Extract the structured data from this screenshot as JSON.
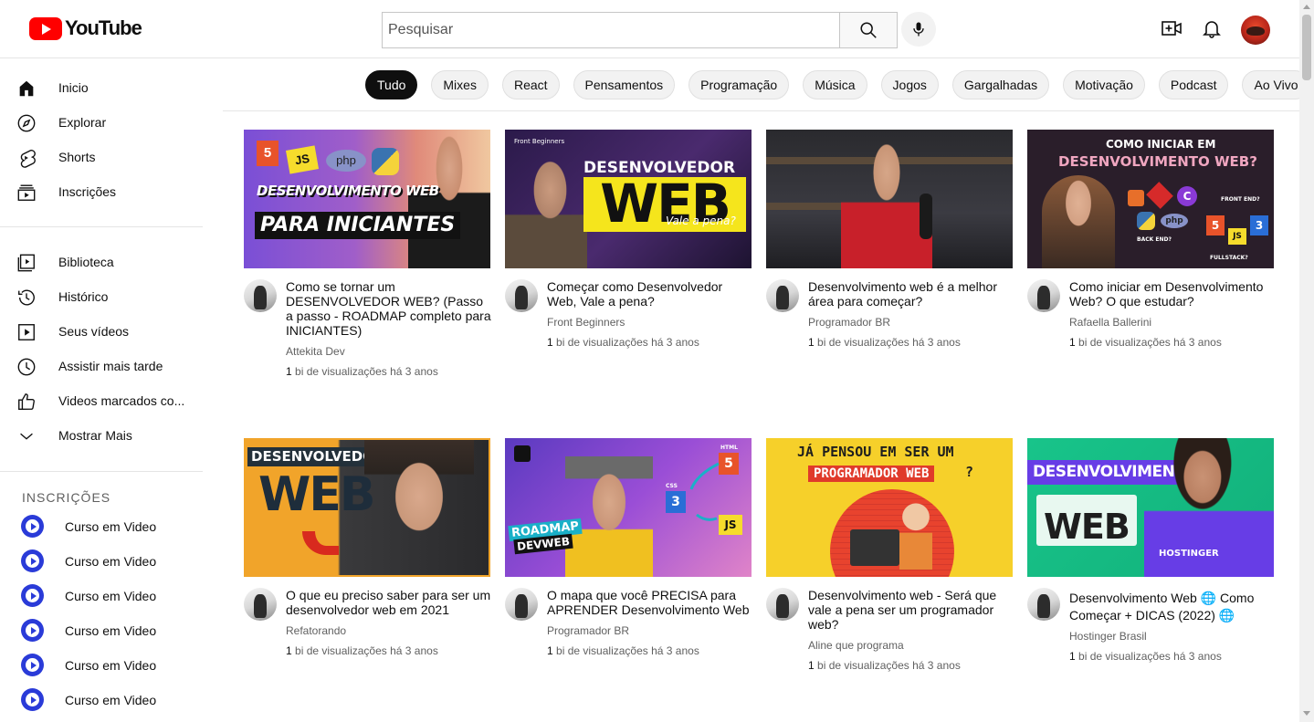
{
  "header": {
    "logo_text": "YouTube",
    "search_placeholder": "Pesquisar"
  },
  "sidebar": {
    "main": [
      {
        "label": "Inicio",
        "icon": "home-icon"
      },
      {
        "label": "Explorar",
        "icon": "compass-icon"
      },
      {
        "label": "Shorts",
        "icon": "shorts-icon"
      },
      {
        "label": "Inscrições",
        "icon": "subscriptions-icon"
      }
    ],
    "library": [
      {
        "label": "Biblioteca",
        "icon": "library-icon"
      },
      {
        "label": "Histórico",
        "icon": "history-icon"
      },
      {
        "label": "Seus vídeos",
        "icon": "your-videos-icon"
      },
      {
        "label": "Assistir mais tarde",
        "icon": "watch-later-icon"
      },
      {
        "label": "Videos marcados co...",
        "icon": "liked-icon"
      },
      {
        "label": "Mostrar Mais",
        "icon": "chevron-down-icon"
      }
    ],
    "subscriptions_title": "INSCRIÇÕES",
    "subscriptions": [
      {
        "label": "Curso em Video"
      },
      {
        "label": "Curso em Video"
      },
      {
        "label": "Curso em Video"
      },
      {
        "label": "Curso em Video"
      },
      {
        "label": "Curso em Video"
      },
      {
        "label": "Curso em Video"
      }
    ]
  },
  "chips": [
    "Tudo",
    "Mixes",
    "React",
    "Pensamentos",
    "Programação",
    "Música",
    "Jogos",
    "Gargalhadas",
    "Motivação",
    "Podcast",
    "Ao Vivo"
  ],
  "thumbs": {
    "t1": {
      "line1": "DESENVOLVIMENTO WEB",
      "line2": "PARA INICIANTES",
      "badges": [
        "5",
        "JS",
        "php"
      ]
    },
    "t2": {
      "brand": "Front Beginners",
      "line1": "DESENVOLVEDOR",
      "line2": "WEB",
      "line3": "Vale a pena?"
    },
    "t4": {
      "line1": "COMO INICIAR EM",
      "line2": "DESENVOLVIMENTO WEB?",
      "front": "FRONT END?",
      "back": "BACK END?",
      "full": "FULLSTACK?",
      "php": "php",
      "js": "JS",
      "five": "5",
      "three": "3",
      "c": "C"
    },
    "t5": {
      "line1": "DESENVOLVEDOR",
      "line2": "WEB"
    },
    "t6": {
      "html": "HTML",
      "css": "CSS",
      "js": "JS",
      "five": "5",
      "three": "3",
      "line1": "ROADMAP",
      "line2": "DEVWEB"
    },
    "t7": {
      "line1": "JÁ PENSOU EM SER UM",
      "line2": "PROGRAMADOR WEB",
      "q": "?"
    },
    "t8": {
      "line1": "DESENVOLVIMENTO",
      "line2": "WEB",
      "brand": "HOSTINGER"
    }
  },
  "videos": [
    {
      "title": "Como se tornar um DESENVOLVEDOR WEB? (Passo a passo - ROADMAP completo para INICIANTES)",
      "channel": "Attekita Dev",
      "views_num": "1",
      "views_rest": "bi de visualizações",
      "age": "há 3 anos"
    },
    {
      "title": "Começar como Desenvolvedor Web, Vale a pena?",
      "channel": "Front Beginners",
      "views_num": "1",
      "views_rest": "bi de visualizações",
      "age": "há 3 anos"
    },
    {
      "title": "Desenvolvimento web é a melhor área para começar?",
      "channel": "Programador BR",
      "views_num": "1",
      "views_rest": "bi de visualizações",
      "age": "há 3 anos"
    },
    {
      "title": "Como iniciar em Desenvolvimento Web? O que estudar?",
      "channel": "Rafaella Ballerini",
      "views_num": "1",
      "views_rest": "bi de visualizações",
      "age": "há 3 anos"
    },
    {
      "title": "O que eu preciso saber para ser um desenvolvedor web em 2021",
      "channel": "Refatorando",
      "views_num": "1",
      "views_rest": "bi de visualizações",
      "age": "há 3 anos"
    },
    {
      "title": "O mapa que você PRECISA para APRENDER Desenvolvimento Web",
      "channel": "Programador BR",
      "views_num": "1",
      "views_rest": "bi de visualizações",
      "age": "há 3 anos"
    },
    {
      "title": "Desenvolvimento web - Será que vale a pena ser um programador web?",
      "channel": "Aline que programa",
      "views_num": "1",
      "views_rest": "bi de visualizações",
      "age": "há 3 anos"
    },
    {
      "title": "Desenvolvimento Web 🌐 Como Começar + DICAS (2022) 🌐",
      "channel": "Hostinger Brasil",
      "views_num": "1",
      "views_rest": "bi de visualizações",
      "age": "há 3 anos"
    }
  ]
}
